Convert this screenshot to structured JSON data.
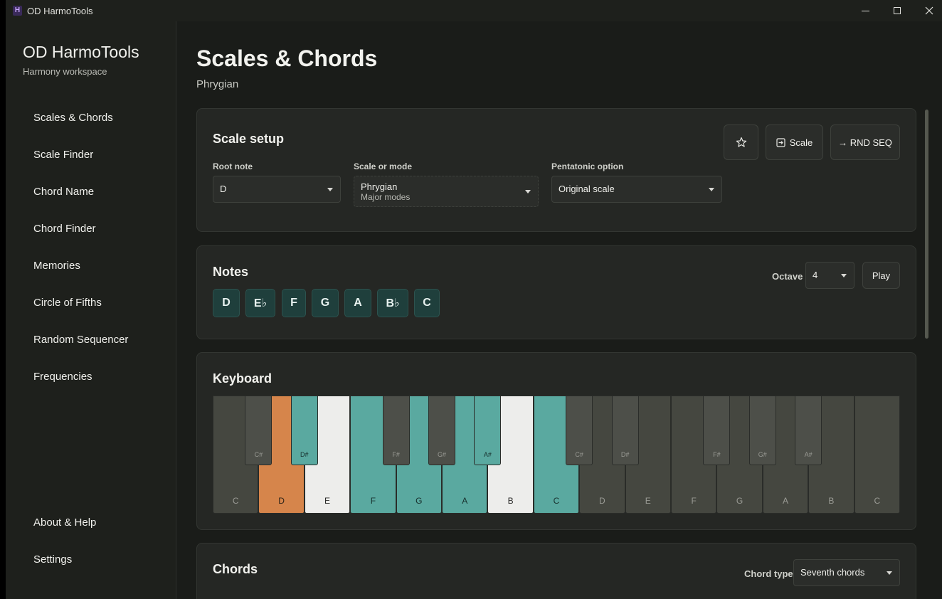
{
  "window": {
    "title": "OD HarmoTools",
    "icon_letter": "H"
  },
  "sidebar": {
    "app_name": "OD HarmoTools",
    "subtitle": "Harmony workspace",
    "items": [
      {
        "label": "Scales & Chords"
      },
      {
        "label": "Scale Finder"
      },
      {
        "label": "Chord Name"
      },
      {
        "label": "Chord Finder"
      },
      {
        "label": "Memories"
      },
      {
        "label": "Circle of Fifths"
      },
      {
        "label": "Random Sequencer"
      },
      {
        "label": "Frequencies"
      }
    ],
    "bottom_items": [
      {
        "label": "About & Help"
      },
      {
        "label": "Settings"
      }
    ]
  },
  "page": {
    "title": "Scales & Chords",
    "subtitle": "Phrygian"
  },
  "scale_setup": {
    "title": "Scale setup",
    "root_label": "Root note",
    "root_value": "D",
    "mode_label": "Scale or mode",
    "mode_value": "Phrygian",
    "mode_group": "Major modes",
    "penta_label": "Pentatonic option",
    "penta_value": "Original scale",
    "favorite_icon": "star-icon",
    "scale_button": "Scale",
    "rnd_button": "→ RND SEQ"
  },
  "notes": {
    "title": "Notes",
    "items": [
      "D",
      "E♭",
      "F",
      "G",
      "A",
      "B♭",
      "C"
    ],
    "octave_label": "Octave",
    "octave_value": "4",
    "play_label": "Play"
  },
  "keyboard": {
    "title": "Keyboard",
    "white_keys": [
      {
        "note": "C",
        "state": "inactive"
      },
      {
        "note": "D",
        "state": "root"
      },
      {
        "note": "E",
        "state": "off"
      },
      {
        "note": "F",
        "state": "scale"
      },
      {
        "note": "G",
        "state": "scale"
      },
      {
        "note": "A",
        "state": "scale"
      },
      {
        "note": "B",
        "state": "off"
      },
      {
        "note": "C",
        "state": "scale"
      },
      {
        "note": "D",
        "state": "inactive"
      },
      {
        "note": "E",
        "state": "inactive"
      },
      {
        "note": "F",
        "state": "inactive"
      },
      {
        "note": "G",
        "state": "inactive"
      },
      {
        "note": "A",
        "state": "inactive"
      },
      {
        "note": "B",
        "state": "inactive"
      },
      {
        "note": "C",
        "state": "inactive"
      }
    ],
    "black_keys": [
      {
        "note": "C#",
        "state": "inactive"
      },
      {
        "note": "D#",
        "state": "scale"
      },
      {
        "note": "F#",
        "state": "inactive"
      },
      {
        "note": "G#",
        "state": "inactive"
      },
      {
        "note": "A#",
        "state": "scale"
      },
      {
        "note": "C#",
        "state": "inactive"
      },
      {
        "note": "D#",
        "state": "inactive"
      },
      {
        "note": "F#",
        "state": "inactive"
      },
      {
        "note": "G#",
        "state": "inactive"
      },
      {
        "note": "A#",
        "state": "inactive"
      }
    ],
    "colors": {
      "root": "#d6854b",
      "scale": "#5aa9a0",
      "off": "#ededeb",
      "inactive": "#454740",
      "black_inactive": "#4d4f49"
    }
  },
  "chords": {
    "title": "Chords",
    "type_label": "Chord type",
    "type_value": "Seventh chords"
  }
}
